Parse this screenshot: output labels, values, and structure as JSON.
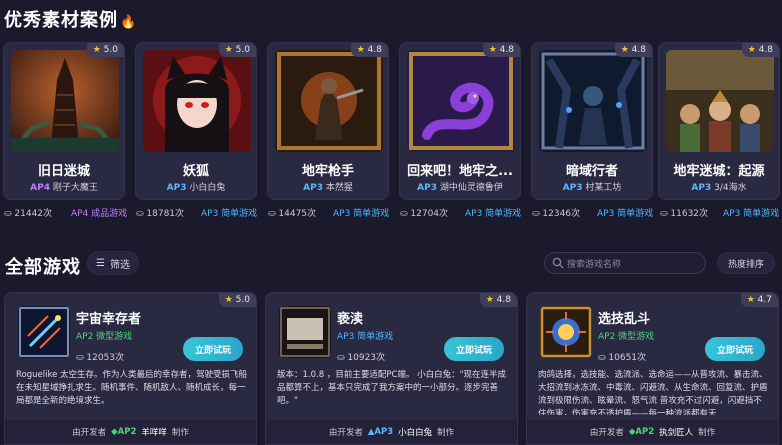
{
  "featured_section": {
    "title": "优秀素材案例",
    "cards": [
      {
        "name": "旧日迷城",
        "rating": "5.0",
        "level": "AP4",
        "author": "刚子大魔王",
        "plays": "21442次",
        "tag": "AP4 成品游戏"
      },
      {
        "name": "妖狐",
        "rating": "5.0",
        "level": "AP3",
        "author": "小白白兔",
        "plays": "18781次",
        "tag": "AP3 简单游戏"
      },
      {
        "name": "地牢枪手",
        "rating": "4.8",
        "level": "AP3",
        "author": "本然猩",
        "plays": "14475次",
        "tag": "AP3 简单游戏"
      },
      {
        "name": "回来吧！地牢之...",
        "rating": "4.8",
        "level": "AP3",
        "author": "湖中仙灵德鲁伊",
        "plays": "12704次",
        "tag": "AP3 简单游戏"
      },
      {
        "name": "暗域行者",
        "rating": "4.8",
        "level": "AP3",
        "author": "村某工坊",
        "plays": "12346次",
        "tag": "AP3 简单游戏"
      },
      {
        "name": "地牢迷城：起源",
        "rating": "4.8",
        "level": "AP3",
        "author": "3/4海水",
        "plays": "11632次",
        "tag": "AP3 简单游戏"
      }
    ]
  },
  "all_games": {
    "title": "全部游戏",
    "filter_label": "筛选",
    "search_placeholder": "搜索游戏名称",
    "sort_label": "热度排序",
    "play_label": "立即试玩",
    "dev_prefix": "由开发者",
    "dev_suffix": "制作",
    "cards": [
      {
        "name": "宇宙幸存者",
        "rating": "5.0",
        "tag": "AP2 微型游戏",
        "level": "AP2",
        "plays": "12053次",
        "desc": "Roguelike 太空生存。作为人类最后的幸存者，驾驶受损飞船在未知星域挣扎求生。随机事件、随机敌人、随机成长，每一局都是全新的绝境求生。",
        "dev": "羊咩咩"
      },
      {
        "name": "亵渎",
        "rating": "4.8",
        "tag": "AP3 简单游戏",
        "level": "AP3",
        "plays": "10923次",
        "desc": "版本：1.0.8 ，目前主要适配PC端。 小白白兔：\"现在连半成品都算不上，基本只完成了我方案中的一小部分。逐步完善吧。\"",
        "dev": "小白白兔"
      },
      {
        "name": "选技乱斗",
        "rating": "4.7",
        "tag": "AP2 微型游戏",
        "level": "AP2",
        "plays": "10651次",
        "desc": "肉鸽选择，选技能、选流派、选命运——从普攻流、暴击流、大招流到冰冻流、中毒流、闪避流、从生命流、回复流、护盾流到极限伤流、眩晕流、怒气流 普攻充不过闪避，闪避挡不住伤害，伤害充不透护盾——每一种流派都有天",
        "dev": "执剑匠人"
      }
    ]
  },
  "colors": {
    "background": "#1b1a2d",
    "card": "#2a2942",
    "accent_cyan": "#39c4d8",
    "ap4": "#c07cff",
    "ap3": "#4ab6ff",
    "ap2": "#4cd37a",
    "star": "#f4c430"
  }
}
